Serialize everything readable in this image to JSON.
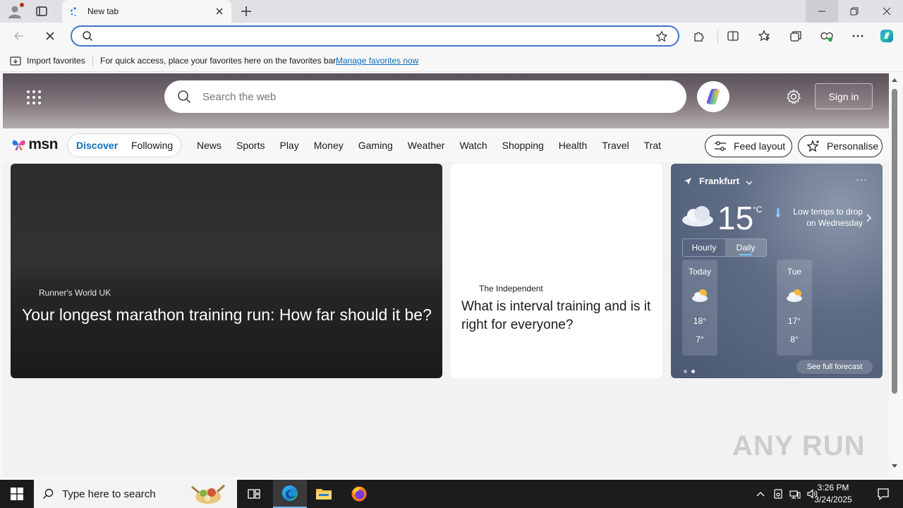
{
  "browser": {
    "tab_title": "New tab",
    "omnibox_value": "",
    "favorites_bar": {
      "import_label": "Import favorites",
      "message": "For quick access, place your favorites here on the favorites bar.",
      "manage_link": "Manage favorites now"
    }
  },
  "msn": {
    "search_placeholder": "Search the web",
    "sign_in": "Sign in",
    "logo_text": "msn",
    "feed_tabs": [
      "Discover",
      "Following"
    ],
    "nav_links": [
      "News",
      "Sports",
      "Play",
      "Money",
      "Gaming",
      "Weather",
      "Watch",
      "Shopping",
      "Health",
      "Travel",
      "Trat"
    ],
    "feed_layout": "Feed layout",
    "personalise": "Personalise",
    "cards": [
      {
        "source": "Runner's World UK",
        "headline": "Your longest marathon training run: How far should it be?"
      },
      {
        "source": "The Independent",
        "headline": "What is interval training and is it right for everyone?"
      }
    ],
    "weather": {
      "location": "Frankfurt",
      "temp": "15",
      "unit": "°C",
      "alert": "Low temps to drop on Wednesday",
      "toggle": [
        "Hourly",
        "Daily"
      ],
      "days": [
        {
          "name": "Today",
          "high": "18°",
          "low": "7°"
        },
        {
          "name": "Tue",
          "high": "17°",
          "low": "8°"
        }
      ],
      "full_forecast": "See full forecast"
    }
  },
  "watermark": "ANY RUN",
  "taskbar": {
    "search_text": "Type here to search",
    "time": "3:26 PM",
    "date": "3/24/2025"
  },
  "colors": {
    "accent": "#0f6cbd",
    "omnibox_border": "#3f76c5",
    "taskbar": "#1c1c1e"
  }
}
